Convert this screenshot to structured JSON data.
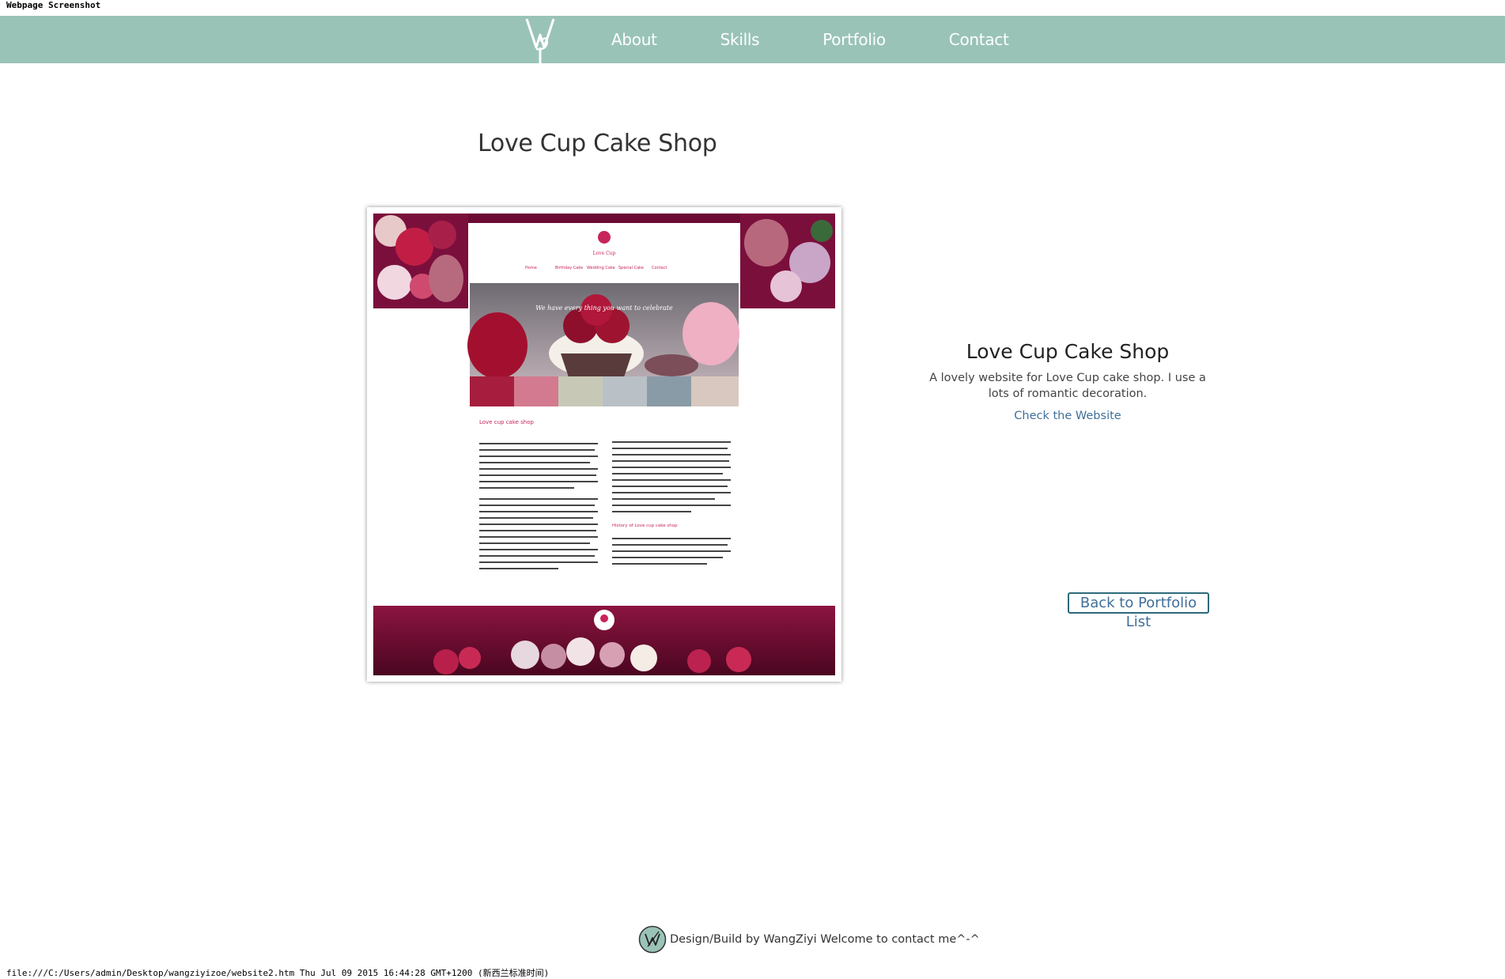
{
  "print_header": "Webpage Screenshot",
  "print_footer": "file:///C:/Users/admin/Desktop/wangziyizoe/website2.htm Thu Jul 09 2015 16:44:28 GMT+1200 (新西兰标准时间)",
  "nav": {
    "items": [
      {
        "label": "About"
      },
      {
        "label": "Skills"
      },
      {
        "label": "Portfolio"
      },
      {
        "label": "Contact"
      }
    ]
  },
  "page": {
    "title": "Love Cup Cake Shop"
  },
  "preview": {
    "nav_items": [
      "Home",
      "Birthday Cake",
      "Wedding Cake",
      "Special Cake",
      "Contact"
    ],
    "banner_text": "We have every thing you want to celebrate",
    "heading": "Love cup cake shop",
    "subheading": "History of Love cup cake shop"
  },
  "info": {
    "title": "Love Cup Cake Shop",
    "description": "A lovely website for Love Cup cake shop. I use a lots of romantic decoration.",
    "link_label": "Check the Website"
  },
  "back_button_label": "Back to Portfolio List",
  "footer": {
    "text": "Design/Build by WangZiyi Welcome to contact me^-^"
  },
  "colors": {
    "nav_bg": "#9ac3b8",
    "link": "#3f6f9a",
    "preview_accent": "#7b0f3c",
    "preview_pink": "#c8245c"
  }
}
